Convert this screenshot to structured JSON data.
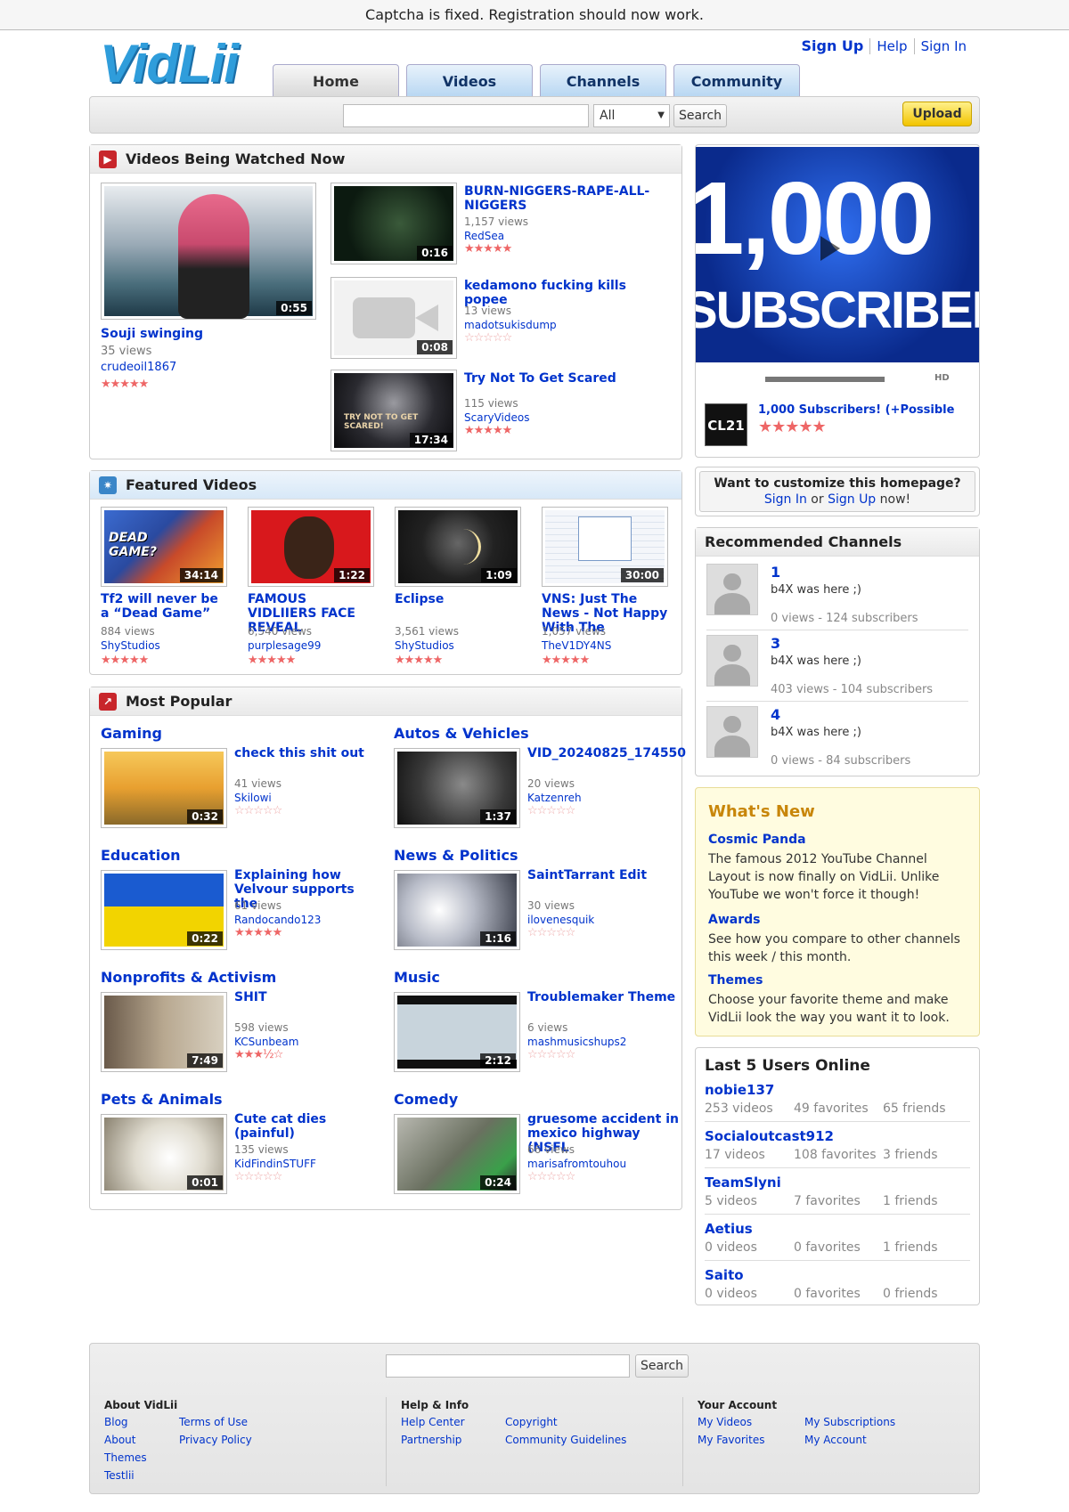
{
  "notice": "Captcha is fixed. Registration should now work.",
  "logo": "VidLii",
  "toplinks": [
    "Sign Up",
    "Help",
    "Sign In"
  ],
  "nav": [
    "Home",
    "Videos",
    "Channels",
    "Community"
  ],
  "search": {
    "select": "All",
    "button": "Search",
    "upload": "Upload"
  },
  "watching": {
    "title": "Videos Being Watched Now",
    "main": {
      "title": "Souji swinging",
      "views": "35 views",
      "user": "crudeoil1867",
      "dur": "0:55"
    },
    "list": [
      {
        "title": "BURN-NIGGERS-RAPE-ALL-NIGGERS",
        "views": "1,157 views",
        "user": "RedSea",
        "dur": "0:16"
      },
      {
        "title": "kedamono fucking kills popee",
        "views": "13 views",
        "user": "madotsukisdump",
        "dur": "0:08"
      },
      {
        "title": "Try Not To Get Scared",
        "views": "115 views",
        "user": "ScaryVideos",
        "dur": "17:34",
        "overlay": "TRY NOT TO GET SCARED!"
      }
    ]
  },
  "featured": {
    "title": "Featured Videos",
    "items": [
      {
        "title": "Tf2 will never be a “Dead Game”",
        "views": "884 views",
        "user": "ShyStudios",
        "dur": "34:14",
        "overlay": "DEAD GAME?"
      },
      {
        "title": "FAMOUS VIDLIIERS FACE REVEAL",
        "views": "6,540 views",
        "user": "purplesage99",
        "dur": "1:22"
      },
      {
        "title": "Eclipse",
        "views": "3,561 views",
        "user": "ShyStudios",
        "dur": "1:09"
      },
      {
        "title": "VNS: Just The News - Not Happy With The",
        "views": "1,057 views",
        "user": "TheV1DY4NS",
        "dur": "30:00"
      }
    ]
  },
  "popular": {
    "title": "Most Popular",
    "cats": [
      {
        "cat": "Gaming",
        "title": "check this shit out",
        "views": "41 views",
        "user": "Skilowi",
        "dur": "0:32"
      },
      {
        "cat": "Autos & Vehicles",
        "title": "VID_20240825_174550",
        "views": "20 views",
        "user": "Katzenreh",
        "dur": "1:37"
      },
      {
        "cat": "Education",
        "title": "Explaining how Velvour supports the",
        "views": "61 views",
        "user": "Randocando123",
        "dur": "0:22"
      },
      {
        "cat": "News & Politics",
        "title": "SaintTarrant Edit",
        "views": "30 views",
        "user": "ilovenesquik",
        "dur": "1:16"
      },
      {
        "cat": "Nonprofits & Activism",
        "title": "SHIT",
        "views": "598 views",
        "user": "KCSunbeam",
        "dur": "7:49"
      },
      {
        "cat": "Music",
        "title": "Troublemaker Theme",
        "views": "6 views",
        "user": "mashmusicshups2",
        "dur": "2:12"
      },
      {
        "cat": "Pets & Animals",
        "title": "Cute cat dies (painful)",
        "views": "135 views",
        "user": "KidFindinSTUFF",
        "dur": "0:01"
      },
      {
        "cat": "Comedy",
        "title": "gruesome accident in mexico highway (NSFL",
        "views": "66 views",
        "user": "marisafromtouhou",
        "dur": "0:24"
      }
    ]
  },
  "player": {
    "big": "1,000",
    "sub": "SUBSCRIBERS",
    "hd": "HD",
    "title": "1,000 Subscribers! (+Possible",
    "avatar": "CL21"
  },
  "customize": {
    "text": "Want to customize this homepage?",
    "signin": "Sign In",
    "or": " or ",
    "signup": "Sign Up",
    "now": " now!"
  },
  "recommended": {
    "title": "Recommended Channels",
    "items": [
      {
        "name": "1",
        "desc": "b4X was here ;)",
        "meta": "0 views - 124 subscribers"
      },
      {
        "name": "3",
        "desc": "b4X was here ;)",
        "meta": "403 views - 104 subscribers"
      },
      {
        "name": "4",
        "desc": "b4X was here ;)",
        "meta": "0 views - 84 subscribers"
      }
    ]
  },
  "whatsnew": {
    "title": "What's New",
    "items": [
      {
        "title": "Cosmic Panda",
        "text": "The famous 2012 YouTube Channel Layout is now finally on VidLii. Unlike YouTube we won't force it though!"
      },
      {
        "title": "Awards",
        "text": "See how you compare to other channels this week / this month."
      },
      {
        "title": "Themes",
        "text": "Choose your favorite theme and make VidLii look the way you want it to look."
      }
    ]
  },
  "lastusers": {
    "title": "Last 5 Users Online",
    "items": [
      {
        "name": "nobie137",
        "videos": "253 videos",
        "favs": "49 favorites",
        "friends": "65 friends"
      },
      {
        "name": "Socialoutcast912",
        "videos": "17 videos",
        "favs": "108 favorites",
        "friends": "3 friends"
      },
      {
        "name": "TeamSlyni",
        "videos": "5 videos",
        "favs": "7 favorites",
        "friends": "1 friends"
      },
      {
        "name": "Aetius",
        "videos": "0 videos",
        "favs": "0 favorites",
        "friends": "1 friends"
      },
      {
        "name": "Saito",
        "videos": "0 videos",
        "favs": "0 favorites",
        "friends": "0 friends"
      }
    ]
  },
  "footer": {
    "search": "Search",
    "about": {
      "title": "About VidLii",
      "col1": [
        "Blog",
        "About",
        "Themes",
        "Testlii"
      ],
      "col2": [
        "Terms of Use",
        "Privacy Policy"
      ]
    },
    "help": {
      "title": "Help & Info",
      "col1": [
        "Help Center",
        "Partnership"
      ],
      "col2": [
        "Copyright",
        "Community Guidelines"
      ]
    },
    "account": {
      "title": "Your Account",
      "col1": [
        "My Videos",
        "My Favorites"
      ],
      "col2": [
        "My Subscriptions",
        "My Account"
      ]
    }
  },
  "ratings": {
    "star": "★★★★★",
    "half": "★★★½☆",
    "empty": "☆☆☆☆☆"
  }
}
